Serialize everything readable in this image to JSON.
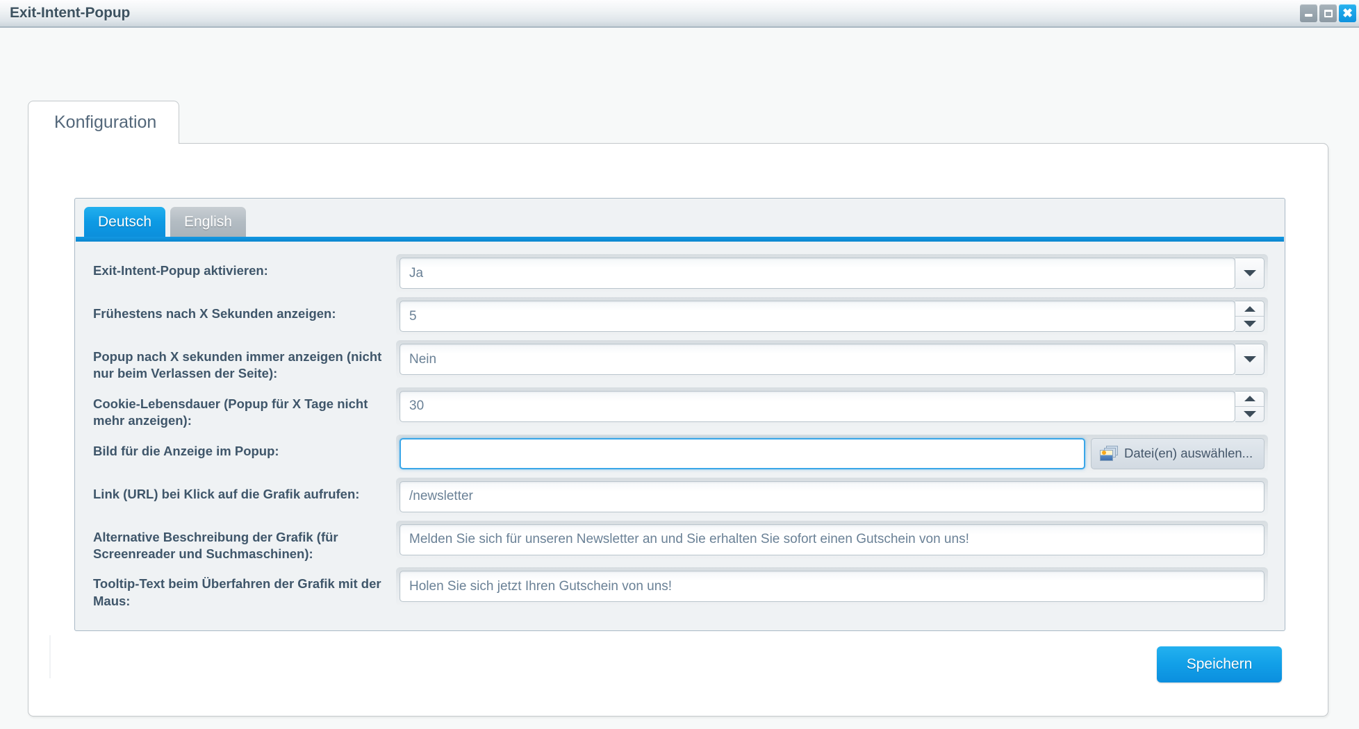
{
  "window": {
    "title": "Exit-Intent-Popup",
    "controls": [
      {
        "name": "minimize-button",
        "icon": "minimize-icon"
      },
      {
        "name": "maximize-button",
        "icon": "maximize-icon"
      },
      {
        "name": "close-button",
        "icon": "close-icon",
        "glyph": "✖"
      }
    ]
  },
  "main_tab": {
    "label": "Konfiguration"
  },
  "language_tabs": [
    {
      "label": "Deutsch",
      "active": true
    },
    {
      "label": "English",
      "active": false
    }
  ],
  "form": {
    "rows": [
      {
        "label": "Exit-Intent-Popup aktivieren:",
        "value": "Ja",
        "control": "select"
      },
      {
        "label": "Frühestens nach X Sekunden anzeigen:",
        "value": "5",
        "control": "spinner"
      },
      {
        "label": "Popup nach X sekunden immer anzeigen (nicht nur beim Verlassen der Seite):",
        "value": "Nein",
        "control": "select"
      },
      {
        "label": "Cookie-Lebensdauer (Popup für X Tage nicht mehr anzeigen):",
        "value": "30",
        "control": "spinner"
      },
      {
        "label": "Bild für die Anzeige im Popup:",
        "value": "",
        "control": "file",
        "button_label": "Datei(en) auswählen...",
        "button_icon": "image-stack-icon",
        "focused": true
      },
      {
        "label": "Link (URL) bei Klick auf die Grafik aufrufen:",
        "value": "/newsletter",
        "control": "text"
      },
      {
        "label": "Alternative Beschreibung der Grafik (für Screenreader und Suchmaschinen):",
        "value": "Melden Sie sich für unseren Newsletter an und Sie erhalten Sie sofort einen Gutschein von uns!",
        "control": "text"
      },
      {
        "label": "Tooltip-Text beim Überfahren der Grafik mit der Maus:",
        "value": "Holen Sie sich jetzt Ihren Gutschein von uns!",
        "control": "text"
      }
    ]
  },
  "footer": {
    "save_label": "Speichern"
  },
  "colors": {
    "accent": "#12a0e8",
    "label_text": "#3f566a",
    "field_text": "#6a8196",
    "panel_bg": "#eff2f4",
    "page_bg": "#f7f9f9"
  }
}
